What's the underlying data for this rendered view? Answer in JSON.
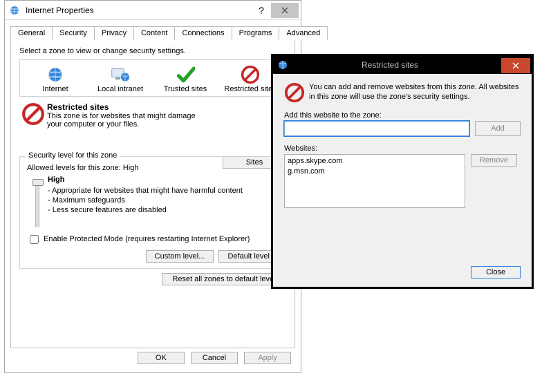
{
  "ip": {
    "title": "Internet Properties",
    "tabs": [
      "General",
      "Security",
      "Privacy",
      "Content",
      "Connections",
      "Programs",
      "Advanced"
    ],
    "zone_prompt": "Select a zone to view or change security settings.",
    "zones": [
      {
        "label": "Internet"
      },
      {
        "label": "Local intranet"
      },
      {
        "label": "Trusted sites"
      },
      {
        "label": "Restricted sites"
      }
    ],
    "selected_zone": {
      "name": "Restricted sites",
      "desc": "This zone is for websites that might damage your computer or your files."
    },
    "sites_btn": "Sites",
    "security_group": "Security level for this zone",
    "allowed_levels": "Allowed levels for this zone: High",
    "level_name": "High",
    "level_lines": [
      "- Appropriate for websites that might have harmful content",
      "- Maximum safeguards",
      "- Less secure features are disabled"
    ],
    "protected_mode": "Enable Protected Mode (requires restarting Internet Explorer)",
    "custom_level": "Custom level...",
    "default_level": "Default level",
    "reset_all": "Reset all zones to default level",
    "ok": "OK",
    "cancel": "Cancel",
    "apply": "Apply"
  },
  "rs": {
    "title": "Restricted sites",
    "info": "You can add and remove websites from this zone. All websites in this zone will use the zone's security settings.",
    "add_label": "Add this website to the zone:",
    "add_btn": "Add",
    "websites_label": "Websites:",
    "websites": [
      "apps.skype.com",
      "g.msn.com"
    ],
    "remove_btn": "Remove",
    "close_btn": "Close"
  }
}
